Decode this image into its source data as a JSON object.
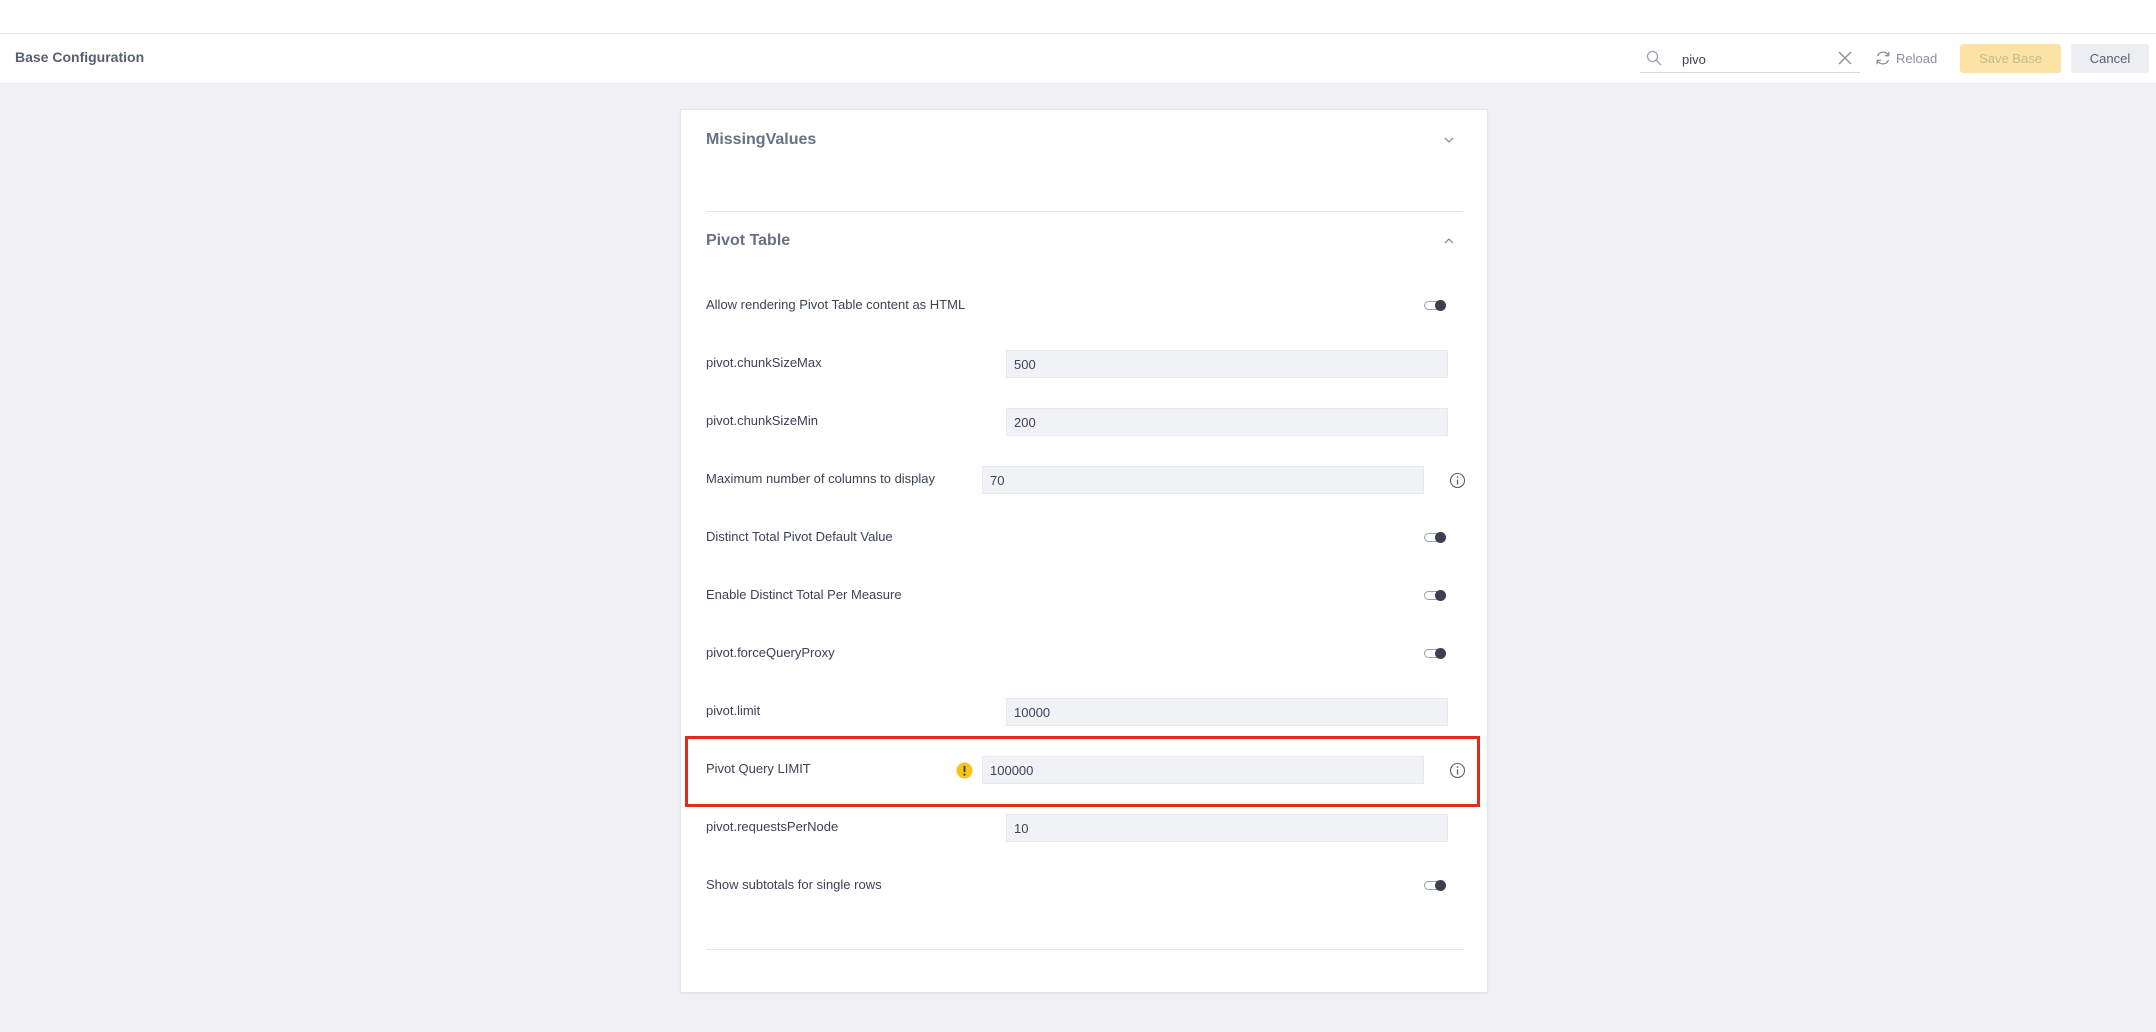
{
  "header": {
    "title": "Base Configuration",
    "search": {
      "value": "pivo",
      "placeholder": ""
    },
    "reload_label": "Reload",
    "save_label": "Save Base",
    "cancel_label": "Cancel"
  },
  "sections": {
    "missing_values": {
      "title": "MissingValues",
      "expanded": false
    },
    "pivot_table": {
      "title": "Pivot Table",
      "expanded": true
    }
  },
  "settings": [
    {
      "label": "Allow rendering Pivot Table content as HTML",
      "type": "toggle",
      "on": true
    },
    {
      "label": "pivot.chunkSizeMax",
      "type": "input",
      "value": "500"
    },
    {
      "label": "pivot.chunkSizeMin",
      "type": "input",
      "value": "200"
    },
    {
      "label": "Maximum number of columns to display",
      "type": "input",
      "value": "70",
      "info": true
    },
    {
      "label": "Distinct Total Pivot Default Value",
      "type": "toggle",
      "on": true
    },
    {
      "label": "Enable Distinct Total Per Measure",
      "type": "toggle",
      "on": true
    },
    {
      "label": "pivot.forceQueryProxy",
      "type": "toggle",
      "on": true
    },
    {
      "label": "pivot.limit",
      "type": "input",
      "value": "10000"
    },
    {
      "label": "Pivot Query LIMIT",
      "type": "input",
      "value": "100000",
      "info": true,
      "warning": true,
      "highlighted": true
    },
    {
      "label": "pivot.requestsPerNode",
      "type": "input",
      "value": "10"
    },
    {
      "label": "Show subtotals for single rows",
      "type": "toggle",
      "on": true
    }
  ],
  "colors": {
    "highlight": "#e12c1c",
    "warning": "#f5c518",
    "save_disabled": "#fbe3a5"
  }
}
